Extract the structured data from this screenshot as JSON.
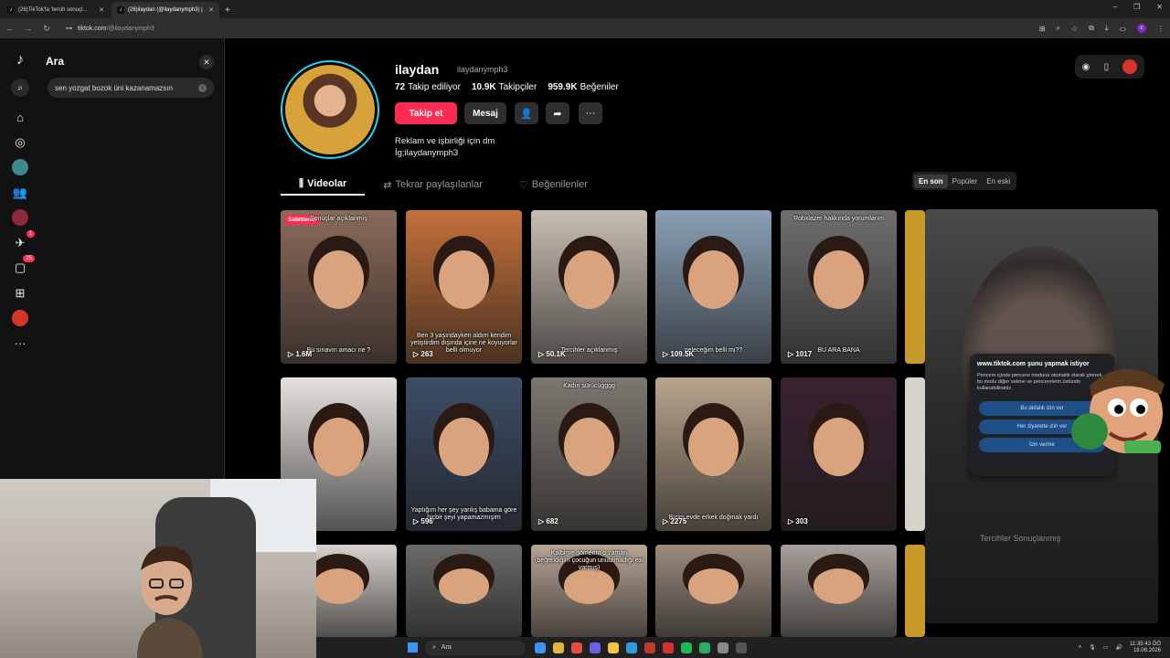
{
  "browser": {
    "tabs": [
      {
        "label": "(26)TikTok'ta 'tercih sonuçl...",
        "active": false
      },
      {
        "label": "(26)ilaydan (@ilaydanymph3) |",
        "active": true
      }
    ],
    "url_host": "tiktok.com",
    "url_path": "/@ilaydanymph3"
  },
  "nav": {
    "messages_badge": "1",
    "inbox_badge": "25"
  },
  "search": {
    "title": "Ara",
    "query": "sen yozgat bozok üni kazanamazsın"
  },
  "profile": {
    "display_name": "ilaydan",
    "handle": "ilaydanymph3",
    "following_count": "72",
    "following_label": "Takip ediliyor",
    "followers_count": "10.9K",
    "followers_label": "Takipçiler",
    "likes_count": "959.9K",
    "likes_label": "Beğeniler",
    "follow_label": "Takip et",
    "message_label": "Mesaj",
    "bio_line1": "Reklam ve işbirliği için dm",
    "bio_line2": "İg;ilaydanymph3"
  },
  "tabs": {
    "videos": "Videolar",
    "reposts": "Tekrar paylaşılanlar",
    "liked": "Beğenilenler"
  },
  "sort": {
    "latest": "En son",
    "popular": "Popüler",
    "oldest": "En eski"
  },
  "videos": [
    {
      "views": "1.6M",
      "pinned": "Sabitlendi",
      "cap_top": "Sonuçlar açıklanmış",
      "cap_bottom": "Bu sınavın amacı ne ?",
      "color": "#8b6b5a"
    },
    {
      "views": "263",
      "cap_top": "",
      "cap_bottom": "Ben 3 yaşındayken aldım kendim yetiştirdim dışında içine ne koyuyorlar belli olmuyor",
      "color": "#c4703a"
    },
    {
      "views": "50.1K",
      "cap_top": "",
      "cap_bottom": "Tercihler açıklanmış",
      "color": "#c9bfb3"
    },
    {
      "views": "109.5K",
      "cap_top": "",
      "cap_bottom": "geleceğim belli mi??",
      "color": "#8aa0b5"
    },
    {
      "views": "1017",
      "cap_top": "Robxlazer hakkında yorumlarım",
      "cap_bottom": "BU ARA BANA",
      "color": "#6f6f6f"
    },
    {
      "views": "698",
      "cap_top": "",
      "cap_bottom": "",
      "color": "#e6e2de"
    },
    {
      "views": "596",
      "cap_top": "",
      "cap_bottom": "Yaptığım her şey yanlış babama göre hiçbir şeyi yapamazmışım",
      "color": "#3d4d66"
    },
    {
      "views": "682",
      "cap_top": "Kadın sürücügggg",
      "cap_bottom": "",
      "color": "#7d7770"
    },
    {
      "views": "2275",
      "cap_top": "",
      "cap_bottom": "Bizim evde erkek doğmak yardı",
      "color": "#b8a48c"
    },
    {
      "views": "303",
      "cap_top": "",
      "cap_bottom": "",
      "color": "#3a2230"
    },
    {
      "views": "",
      "cap_top": "",
      "cap_bottom": "",
      "color": "#d8d2cc"
    },
    {
      "views": "",
      "cap_top": "",
      "cap_bottom": "",
      "color": "#6b6a68"
    },
    {
      "views": "",
      "cap_top": "Kalbime gömerim o zaman (beğendiğim çocuğun unutamadığı exi varmış)",
      "cap_bottom": "",
      "color": "#b7a595"
    },
    {
      "views": "",
      "cap_top": "",
      "cap_bottom": "",
      "color": "#9c8b7e"
    },
    {
      "views": "",
      "cap_top": "",
      "cap_bottom": "",
      "color": "#a9a09a"
    }
  ],
  "pip": {
    "caption": "Tercihler Sonuçlanmış"
  },
  "permission_dialog": {
    "title": "www.tiktok.com şunu yapmak istiyor",
    "text": "Pencere içinde pencere moduna otomatik olarak girerek bu modu diğer sekme ve pencerelerin üstünde kullanabilirsiniz.",
    "allow_once": "Bu defalık izin ver",
    "allow_always": "Her ziyarette izin ver",
    "deny": "İzin verme"
  },
  "taskbar": {
    "search_label": "Ara",
    "time": "11:35:43 ÖÖ",
    "date": "18.08.2026"
  },
  "colors": {
    "accent": "#fe2c55",
    "ring": "#20d5ec"
  }
}
